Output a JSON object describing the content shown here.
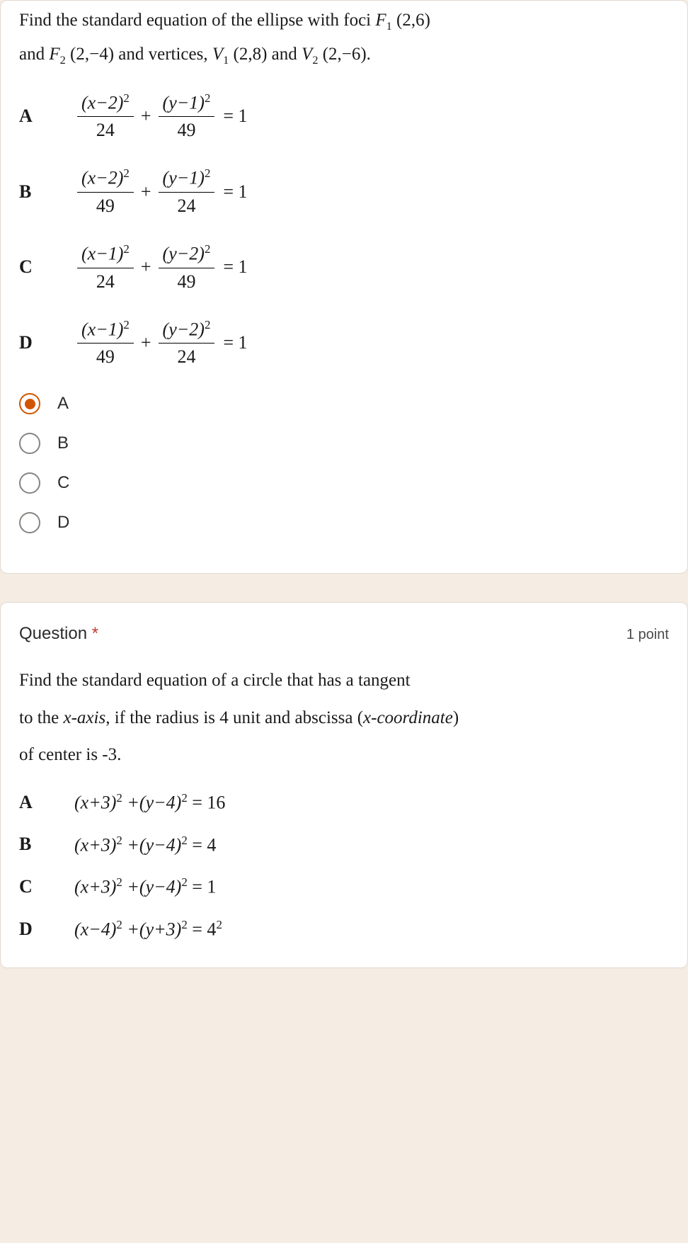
{
  "q1": {
    "prompt_line1_pre": "Find the standard equation of the ellipse with foci ",
    "f1": "F",
    "f1sub": "1",
    "f1coords": "(2,6)",
    "prompt_line2_pre": "and ",
    "f2": "F",
    "f2sub": "2",
    "f2coords": "(2,−4)",
    "vertices_pre": " and vertices, ",
    "v1": "V",
    "v1sub": "1",
    "v1coords": "(2,8)",
    "and": " and ",
    "v2": "V",
    "v2sub": "2",
    "v2coords": "(2,−6).",
    "options": [
      {
        "label": "A",
        "num1": "(x−2)",
        "den1": "24",
        "num2": "(y−1)",
        "den2": "49"
      },
      {
        "label": "B",
        "num1": "(x−2)",
        "den1": "49",
        "num2": "(y−1)",
        "den2": "24"
      },
      {
        "label": "C",
        "num1": "(x−1)",
        "den1": "24",
        "num2": "(y−2)",
        "den2": "49"
      },
      {
        "label": "D",
        "num1": "(x−1)",
        "den1": "49",
        "num2": "(y−2)",
        "den2": "24"
      }
    ],
    "plus": "+",
    "eq1": "= 1",
    "sq": "2",
    "radios": [
      "A",
      "B",
      "C",
      "D"
    ],
    "selected": 0
  },
  "q2": {
    "title": "Question ",
    "required": "*",
    "points": "1 point",
    "prompt_l1": "Find the standard equation of a circle that has a tangent",
    "prompt_l2_pre": "to the ",
    "xaxis": "x-axis",
    "prompt_l2_post": ", if the radius is 4 unit and abscissa (",
    "xcoord": "x-coordinate",
    "prompt_l2_end": ")",
    "prompt_l3": "of center is -3.",
    "options": [
      {
        "label": "A",
        "t1": "(x+3)",
        "t2": "+(y−4)",
        "rhs": "= 16"
      },
      {
        "label": "B",
        "t1": "(x+3)",
        "t2": "+(y−4)",
        "rhs": "= 4"
      },
      {
        "label": "C",
        "t1": "(x+3)",
        "t2": "+(y−4)",
        "rhs": "= 1"
      },
      {
        "label": "D",
        "t1": "(x−4)",
        "t2": "+(y+3)",
        "rhs": "= 4",
        "rhsexp": "2"
      }
    ],
    "sq": "2"
  }
}
